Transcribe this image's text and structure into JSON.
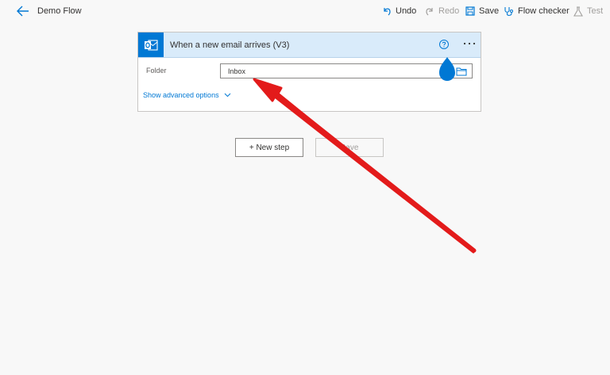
{
  "header": {
    "flow_title": "Demo Flow",
    "undo_label": "Undo",
    "redo_label": "Redo",
    "save_label": "Save",
    "flow_checker_label": "Flow checker",
    "test_label": "Test"
  },
  "trigger_card": {
    "title": "When a new email arrives (V3)",
    "folder_label": "Folder",
    "folder_value": "Inbox",
    "advanced_label": "Show advanced options"
  },
  "actions": {
    "new_step_label": "+ New step",
    "save_label": "Save"
  },
  "colors": {
    "accent": "#0078d4",
    "header_bg": "#d9ebfa",
    "annotation_arrow": "#e31b1b"
  }
}
